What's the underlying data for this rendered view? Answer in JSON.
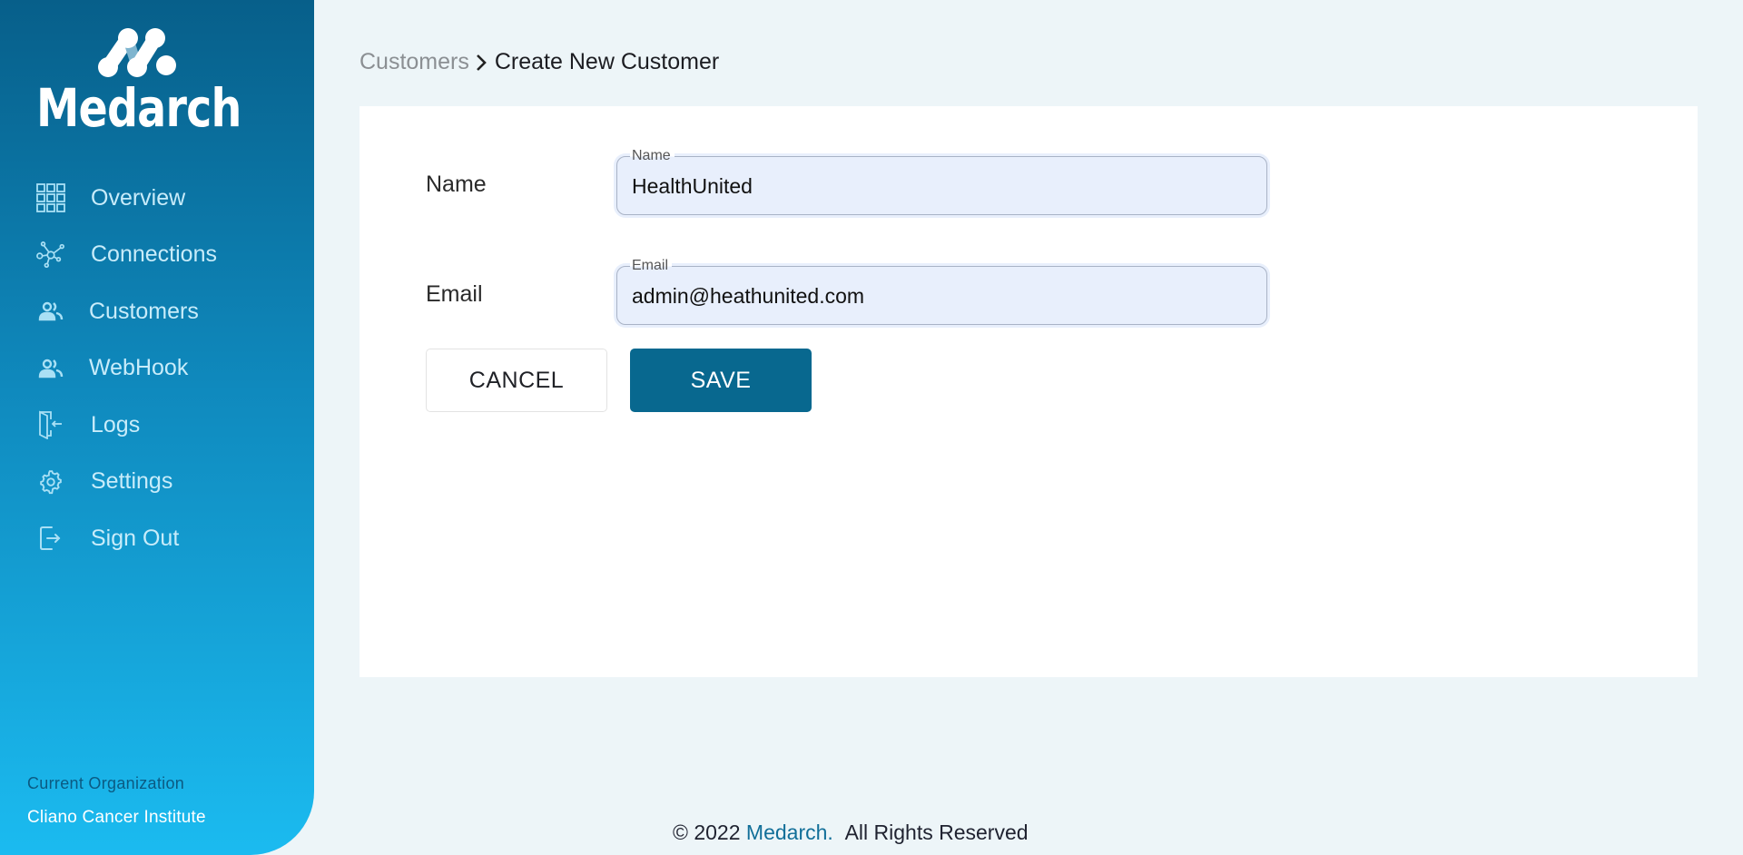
{
  "app": {
    "brand": "Medarch"
  },
  "sidebar": {
    "items": [
      {
        "label": "Overview",
        "icon": "grid-icon"
      },
      {
        "label": "Connections",
        "icon": "network-icon"
      },
      {
        "label": "Customers",
        "icon": "users-icon"
      },
      {
        "label": "WebHook",
        "icon": "users-icon"
      },
      {
        "label": "Logs",
        "icon": "door-enter-icon"
      },
      {
        "label": "Settings",
        "icon": "gear-icon"
      },
      {
        "label": "Sign Out",
        "icon": "sign-out-icon"
      }
    ],
    "org_caption": "Current Organization",
    "org_name": "Cliano Cancer Institute"
  },
  "breadcrumb": {
    "parent": "Customers",
    "current": "Create New Customer"
  },
  "form": {
    "name": {
      "label": "Name",
      "legend": "Name",
      "value": "HealthUnited"
    },
    "email": {
      "label": "Email",
      "legend": "Email",
      "value": "admin@heathunited.com"
    },
    "cancel_label": "CANCEL",
    "save_label": "SAVE"
  },
  "footer": {
    "prefix": "© 2022",
    "brand": "Medarch.",
    "suffix": "All Rights Reserved"
  },
  "colors": {
    "primary": "#08688f",
    "sidebar_top": "#075f8a",
    "sidebar_bottom": "#1bbbf0",
    "background": "#edf5f8",
    "input_bg": "#e8effc"
  }
}
